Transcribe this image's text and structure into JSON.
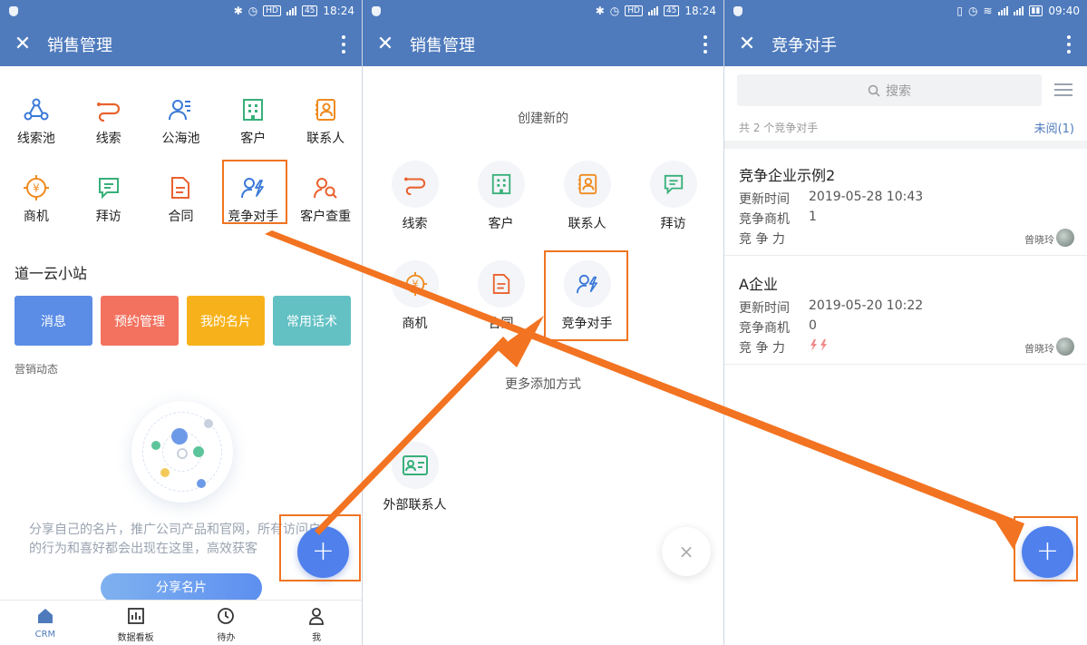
{
  "status": {
    "time_left": "18:24",
    "time_mid": "18:24",
    "time_right": "09:40",
    "hd": "HD",
    "battery": "45"
  },
  "panel1": {
    "title": "销售管理",
    "grid_row1": [
      {
        "label": "线索池",
        "icon": "graph-nodes-icon",
        "color": "#3a79d8"
      },
      {
        "label": "线索",
        "icon": "flow-icon",
        "color": "#e9622f"
      },
      {
        "label": "公海池",
        "icon": "people-icon",
        "color": "#3a79d8"
      },
      {
        "label": "客户",
        "icon": "building-icon",
        "color": "#38b07a"
      },
      {
        "label": "联系人",
        "icon": "contact-card-icon",
        "color": "#f08a1d"
      }
    ],
    "grid_row2": [
      {
        "label": "商机",
        "icon": "yuan-target-icon",
        "color": "#f08a1d"
      },
      {
        "label": "拜访",
        "icon": "message-icon",
        "color": "#38b07a"
      },
      {
        "label": "合同",
        "icon": "document-icon",
        "color": "#e9622f"
      },
      {
        "label": "竞争对手",
        "icon": "competitor-icon",
        "color": "#3a79d8"
      },
      {
        "label": "客户查重",
        "icon": "user-search-icon",
        "color": "#e9622f"
      }
    ],
    "section_title": "道一云小站",
    "tiles": [
      {
        "label": "消息",
        "color": "#5b8de6"
      },
      {
        "label": "预约管理",
        "color": "#f2725f"
      },
      {
        "label": "我的名片",
        "color": "#f7b21b"
      },
      {
        "label": "常用话术",
        "color": "#63c1c4"
      }
    ],
    "small_title": "营销动态",
    "description": "分享自己的名片，推广公司产品和官网，所有访问户的行为和喜好都会出现在这里，高效获客",
    "share_button": "分享名片",
    "tabs": [
      {
        "label": "CRM",
        "icon": "home-icon"
      },
      {
        "label": "数据看板",
        "icon": "chart-icon"
      },
      {
        "label": "待办",
        "icon": "clock-icon"
      },
      {
        "label": "我",
        "icon": "user-icon"
      }
    ],
    "fab": "+"
  },
  "panel2": {
    "title": "销售管理",
    "create_title": "创建新的",
    "row1": [
      {
        "label": "线索",
        "icon": "flow-icon"
      },
      {
        "label": "客户",
        "icon": "building-icon"
      },
      {
        "label": "联系人",
        "icon": "contact-card-icon"
      },
      {
        "label": "拜访",
        "icon": "message-icon"
      }
    ],
    "row2": [
      {
        "label": "商机",
        "icon": "yuan-target-icon"
      },
      {
        "label": "合同",
        "icon": "document-icon"
      },
      {
        "label": "竞争对手",
        "icon": "competitor-icon"
      }
    ],
    "more_title": "更多添加方式",
    "external": {
      "label": "外部联系人",
      "icon": "id-card-icon"
    },
    "close": "×"
  },
  "panel3": {
    "title": "竞争对手",
    "search_placeholder": "搜索",
    "summary": "共 2 个竞争对手",
    "unread": "未阅(1)",
    "cards": [
      {
        "name": "竞争企业示例2",
        "k1": "更新时间",
        "v1": "2019-05-28 10:43",
        "k2": "竞争商机",
        "v2": "1",
        "k3": "竞 争 力",
        "v3": "",
        "owner": "曾晓玲"
      },
      {
        "name": "A企业",
        "k1": "更新时间",
        "v1": "2019-05-20 10:22",
        "k2": "竞争商机",
        "v2": "0",
        "k3": "竞 争 力",
        "v3": "",
        "owner": "曾晓玲"
      }
    ],
    "fab": "+"
  },
  "colors": {
    "brand": "#4f7bbd",
    "fab": "#4f80ec",
    "highlight": "#ef7421"
  }
}
